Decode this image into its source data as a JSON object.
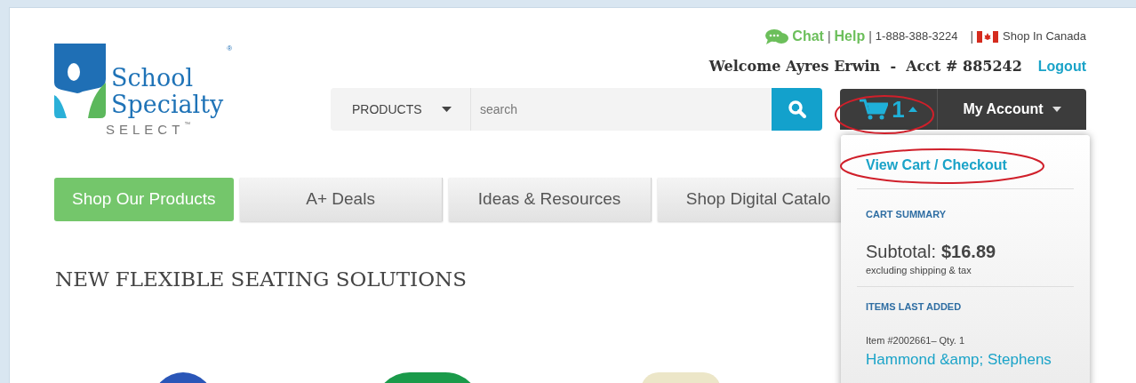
{
  "logo": {
    "line1": "School",
    "line2": "Specialty",
    "tagline": "SELECT",
    "tm": "™",
    "reg": "®"
  },
  "top_links": [
    {
      "kind": "chat",
      "label": "Chat"
    },
    {
      "kind": "sep",
      "label": "|"
    },
    {
      "kind": "link",
      "label": "Help"
    },
    {
      "kind": "sep",
      "label": "|"
    },
    {
      "kind": "text",
      "label": "1-888-388-3224"
    },
    {
      "kind": "sep",
      "label": "|"
    },
    {
      "kind": "country",
      "label": "Shop In Canada"
    }
  ],
  "account": {
    "welcome": "Welcome Ayres Erwin  -  Acct # 885242",
    "logout": "Logout"
  },
  "search": {
    "category": "PRODUCTS",
    "placeholder": "search"
  },
  "cart": {
    "count": "1",
    "expanded": true
  },
  "my_account": "My Account",
  "cart_menu": {
    "link": "View Cart / Checkout",
    "summary_title": "CART SUMMARY",
    "subtotal_label": "Subtotal:",
    "subtotal": "$16.89",
    "note": "excluding shipping & tax",
    "recent_title": "ITEMS LAST ADDED",
    "item_meta": "Item #2002661– Qty. 1",
    "item_name": "Hammond &amp; Stephens"
  },
  "nav": [
    {
      "label": "Shop Our Products",
      "selected": true
    },
    {
      "label": "A+ Deals",
      "selected": false
    },
    {
      "label": "Ideas & Resources",
      "selected": false
    },
    {
      "label": "Shop Digital Catalo",
      "selected": false
    }
  ],
  "heading": "NEW FLEXIBLE SEATING SOLUTIONS"
}
